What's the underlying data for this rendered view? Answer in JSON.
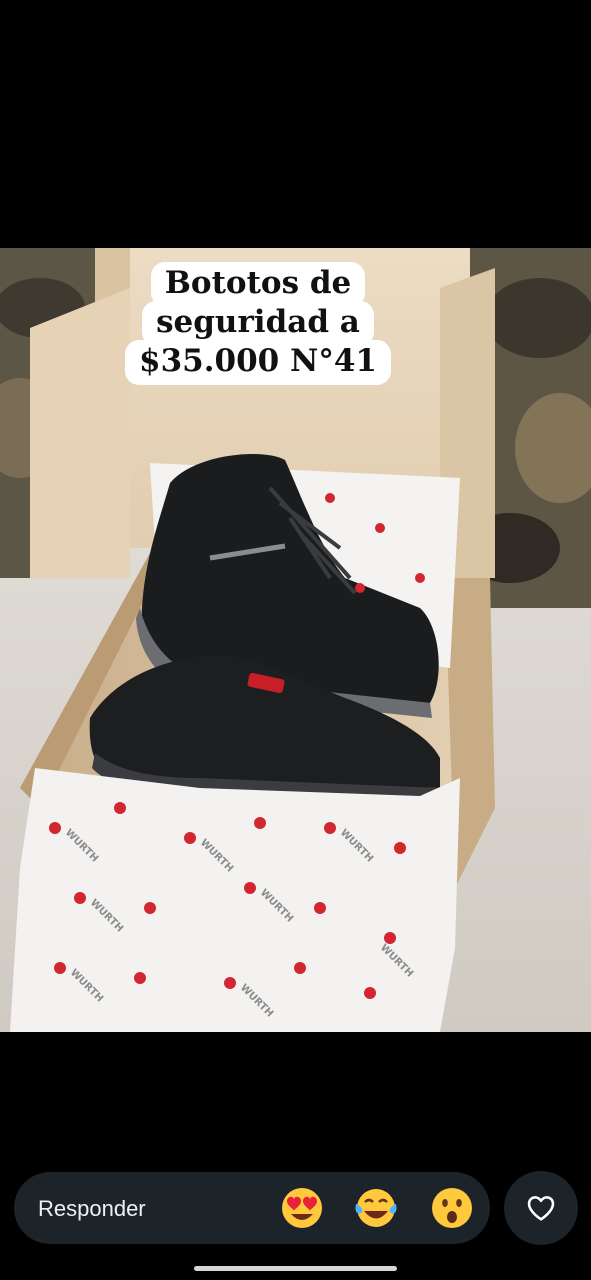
{
  "story": {
    "caption_lines": [
      "Bototos de",
      "seguridad a",
      "$35.000 N°41"
    ]
  },
  "reply_bar": {
    "placeholder": "Responder",
    "quick_reactions": [
      "heart-eyes-emoji",
      "tears-of-joy-emoji",
      "surprised-emoji"
    ]
  },
  "actions": {
    "like_icon": "heart-outline-icon"
  },
  "photo": {
    "tissue_print": "WURTH",
    "label": "WURTH"
  }
}
